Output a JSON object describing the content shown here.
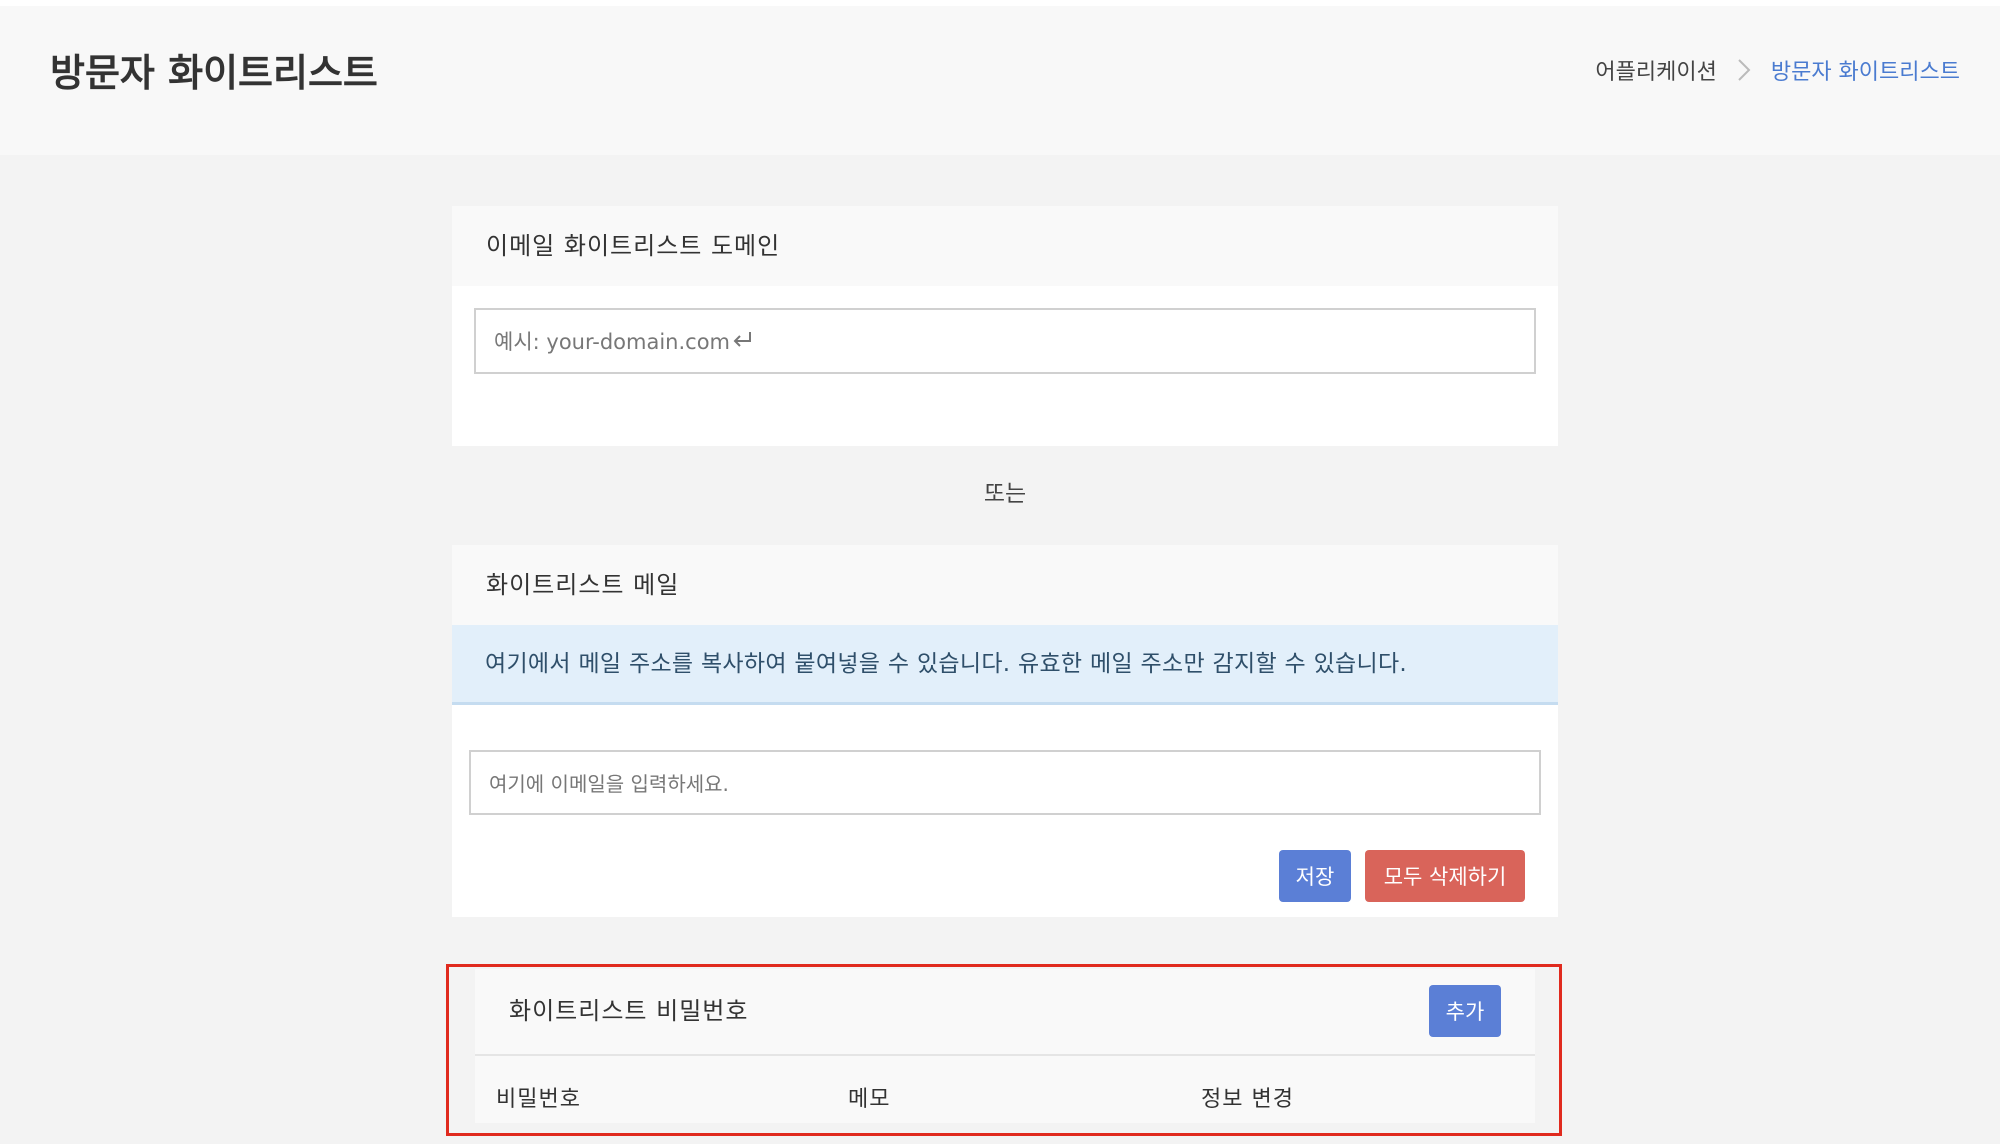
{
  "header": {
    "title": "방문자 화이트리스트",
    "breadcrumb": {
      "parent": "어플리케이션",
      "current": "방문자 화이트리스트"
    }
  },
  "domain_card": {
    "title": "이메일 화이트리스트 도메인",
    "input_placeholder": "예시: your-domain.com",
    "return_icon": "return-arrow-icon"
  },
  "separator": {
    "text": "또는"
  },
  "email_card": {
    "title": "화이트리스트 메일",
    "info_text": "여기에서 메일 주소를 복사하여 붙여넣을 수 있습니다. 유효한 메일 주소만 감지할 수 있습니다.",
    "input_placeholder": "여기에 이메일을 입력하세요.",
    "save_label": "저장",
    "delete_all_label": "모두 삭제하기"
  },
  "password_card": {
    "title": "화이트리스트 비밀번호",
    "add_label": "추가",
    "columns": [
      "비밀번호",
      "메모",
      "정보 변경"
    ]
  },
  "colors": {
    "primary": "#5b7fd6",
    "danger": "#d9645a",
    "info_bg": "#e2effa",
    "breadcrumb_active": "#4a7bd0",
    "highlight": "#e02a1e"
  }
}
